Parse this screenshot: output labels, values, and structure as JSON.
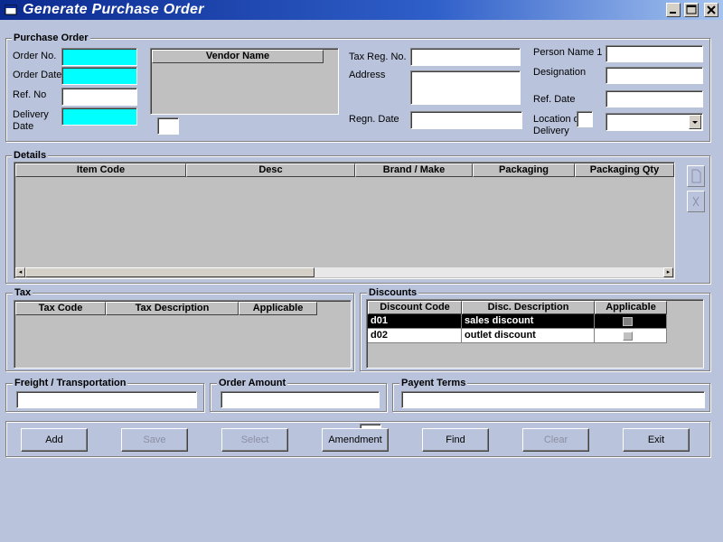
{
  "window": {
    "title": "Generate Purchase Order"
  },
  "purchase_order": {
    "group_title": "Purchase Order",
    "order_no_label": "Order No.",
    "order_date_label": "Order Date",
    "ref_no_label": "Ref. No",
    "delivery_date_label_1": "Delivery",
    "delivery_date_label_2": "Date",
    "vendor_name_header": "Vendor Name",
    "tax_reg_no_label": "Tax Reg. No.",
    "address_label": "Address",
    "regn_date_label": "Regn. Date",
    "person_name_label": "Person Name 1",
    "designation_label": "Designation",
    "ref_date_label": "Ref. Date",
    "location_label_1": "Location o",
    "location_label_2": "Delivery"
  },
  "details": {
    "group_title": "Details",
    "columns": [
      "Item Code",
      "Desc",
      "Brand / Make",
      "Packaging",
      "Packaging Qty"
    ]
  },
  "tax": {
    "group_title": "Tax",
    "columns": [
      "Tax Code",
      "Tax Description",
      "Applicable"
    ]
  },
  "discounts": {
    "group_title": "Discounts",
    "columns": [
      "Discount Code",
      "Disc. Description",
      "Applicable"
    ],
    "rows": [
      {
        "code": "d01",
        "description": "sales discount",
        "selected": true
      },
      {
        "code": "d02",
        "description": "outlet discount",
        "selected": false
      }
    ]
  },
  "freight": {
    "group_title": "Freight / Transportation"
  },
  "order_amount": {
    "group_title": "Order Amount"
  },
  "payment_terms": {
    "group_title": "Payent Terms"
  },
  "buttons": {
    "add": "Add",
    "save": "Save",
    "select": "Select",
    "amendment": "Amendment",
    "find": "Find",
    "clear": "Clear",
    "exit": "Exit"
  },
  "colors": {
    "background": "#b9c3dc",
    "mandatory_field": "#00ffff",
    "titlebar_start": "#0b2a8f",
    "titlebar_end": "#a6c4ef"
  }
}
